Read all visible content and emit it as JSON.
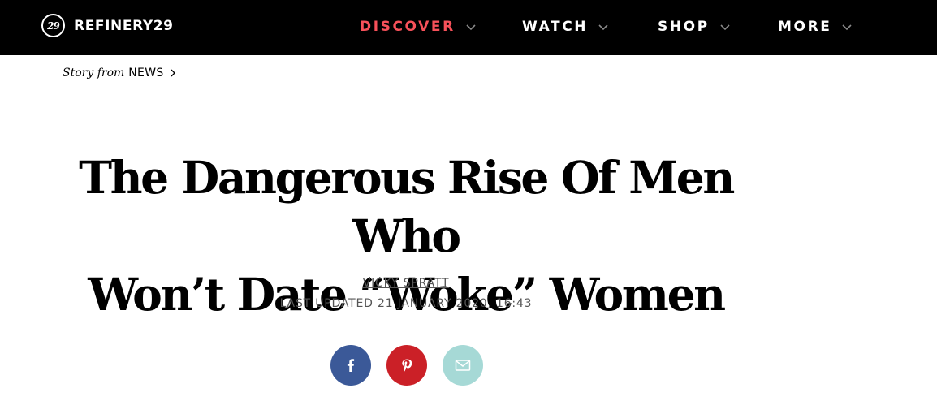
{
  "header": {
    "logo_text": "REFINERY29",
    "logo_mark": "29",
    "nav": [
      {
        "label": "DISCOVER",
        "active": true
      },
      {
        "label": "WATCH"
      },
      {
        "label": "SHOP"
      },
      {
        "label": "MORE"
      }
    ]
  },
  "breadcrumb": {
    "prefix": "Story from",
    "section": "NEWS"
  },
  "article": {
    "title_line1": "The Dangerous Rise Of Men Who",
    "title_line2": "Won’t Date “Woke” Women",
    "author": "VICKY SPRATT",
    "updated_label": "LAST UPDATED",
    "updated_date": "21 JANUARY 2020, 16:43"
  },
  "share": [
    {
      "network": "facebook",
      "icon": "facebook-icon",
      "color": "#3b5998"
    },
    {
      "network": "pinterest",
      "icon": "pinterest-icon",
      "color": "#cb2027"
    },
    {
      "network": "email",
      "icon": "email-icon",
      "color": "#a6d9d6"
    }
  ],
  "colors": {
    "topbar": "#000000",
    "accent": "#f7515a",
    "meta_text": "#555555"
  }
}
